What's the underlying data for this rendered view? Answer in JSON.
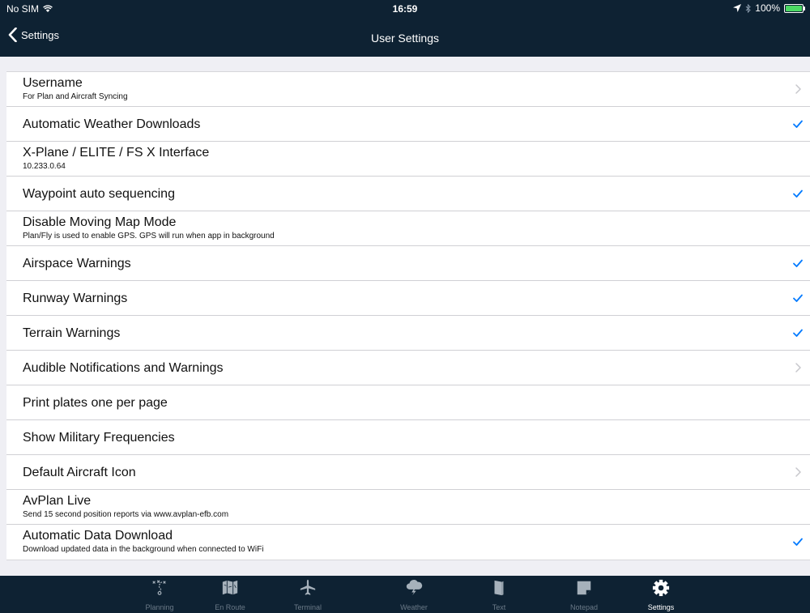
{
  "status_bar": {
    "carrier": "No SIM",
    "time": "16:59",
    "battery": "100%"
  },
  "nav": {
    "back_label": "Settings",
    "title": "User Settings"
  },
  "settings": [
    {
      "title": "Username",
      "subtitle": "For Plan and Aircraft Syncing",
      "accessory": "chevron"
    },
    {
      "title": "Automatic Weather Downloads",
      "subtitle": "",
      "accessory": "check"
    },
    {
      "title": "X-Plane / ELITE / FS X Interface",
      "subtitle": "10.233.0.64",
      "accessory": "none"
    },
    {
      "title": "Waypoint auto sequencing",
      "subtitle": "",
      "accessory": "check"
    },
    {
      "title": "Disable Moving Map Mode",
      "subtitle": "Plan/Fly is used to enable GPS. GPS will run when app in background",
      "accessory": "none"
    },
    {
      "title": "Airspace Warnings",
      "subtitle": "",
      "accessory": "check"
    },
    {
      "title": "Runway Warnings",
      "subtitle": "",
      "accessory": "check"
    },
    {
      "title": "Terrain Warnings",
      "subtitle": "",
      "accessory": "check"
    },
    {
      "title": "Audible Notifications and Warnings",
      "subtitle": "",
      "accessory": "chevron"
    },
    {
      "title": "Print plates one per page",
      "subtitle": "",
      "accessory": "none"
    },
    {
      "title": "Show Military Frequencies",
      "subtitle": "",
      "accessory": "none"
    },
    {
      "title": "Default Aircraft Icon",
      "subtitle": "",
      "accessory": "chevron"
    },
    {
      "title": "AvPlan Live",
      "subtitle": "Send 15 second position reports via www.avplan-efb.com",
      "accessory": "none"
    },
    {
      "title": "Automatic Data Download",
      "subtitle": "Download updated data in the background when connected to WiFi",
      "accessory": "check"
    }
  ],
  "tabs": [
    {
      "label": "Planning",
      "icon": "planning-icon",
      "active": false
    },
    {
      "label": "En Route",
      "icon": "map-icon",
      "active": false
    },
    {
      "label": "Terminal",
      "icon": "airplane-icon",
      "active": false
    },
    {
      "label": "Weather",
      "icon": "weather-icon",
      "active": false
    },
    {
      "label": "Text",
      "icon": "book-icon",
      "active": false
    },
    {
      "label": "Notepad",
      "icon": "notepad-icon",
      "active": false
    },
    {
      "label": "Settings",
      "icon": "gear-icon",
      "active": true
    }
  ],
  "colors": {
    "bar": "#0e2233",
    "accent": "#007aff",
    "chevron": "#c7c7cc",
    "tab_inactive": "#6b7a88"
  }
}
